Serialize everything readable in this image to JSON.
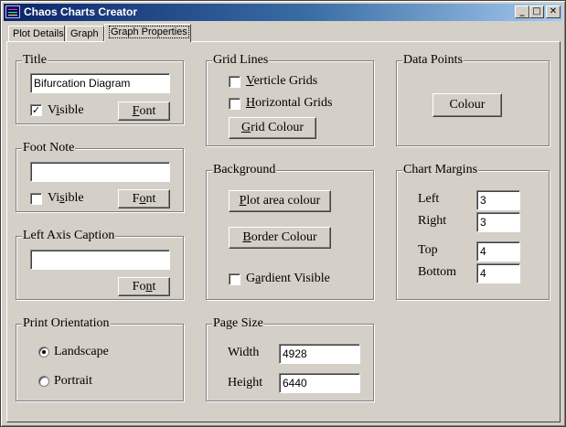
{
  "window": {
    "title": "Chaos Charts Creator",
    "controls": {
      "minimize": "_",
      "maximize": "□",
      "close": "✕"
    }
  },
  "tabs": [
    {
      "label": "Plot Details",
      "active": false
    },
    {
      "label": "Graph",
      "active": false
    },
    {
      "label": "Graph Properties",
      "active": true
    }
  ],
  "title_group": {
    "label": "Title",
    "value": "Bifurcation Diagram",
    "visible_label_pre": "V",
    "visible_label_ul": "i",
    "visible_label_post": "sible",
    "visible_checked": true,
    "font_label_pre": "",
    "font_label_ul": "F",
    "font_label_post": "ont"
  },
  "footnote_group": {
    "label": "Foot Note",
    "value": "",
    "visible_label_pre": "Vi",
    "visible_label_ul": "s",
    "visible_label_post": "ible",
    "visible_checked": false,
    "font_label_pre": "F",
    "font_label_ul": "o",
    "font_label_post": "nt"
  },
  "left_axis_group": {
    "label": "Left Axis Caption",
    "value": "",
    "font_label_pre": "Fo",
    "font_label_ul": "n",
    "font_label_post": "t"
  },
  "print_orientation": {
    "label": "Print Orientation",
    "options": [
      {
        "label": "Landscape",
        "selected": true
      },
      {
        "label": "Portrait",
        "selected": false
      }
    ]
  },
  "grid_lines": {
    "label": "Grid Lines",
    "verticle_ul": "V",
    "verticle_rest": "erticle Grids",
    "verticle_checked": false,
    "horizontal_ul": "H",
    "horizontal_rest": "orizontal Grids",
    "horizontal_checked": false,
    "colour_ul": "G",
    "colour_rest": "rid Colour"
  },
  "background": {
    "label": "Background",
    "plot_ul": "P",
    "plot_rest": "lot area colour",
    "border_ul": "B",
    "border_rest": "order Colour",
    "gradient_pre": "G",
    "gradient_ul": "a",
    "gradient_post": "rdient Visible",
    "gradient_checked": false
  },
  "page_size": {
    "label": "Page Size",
    "width_label": "Width",
    "width_value": "4928",
    "height_label": "Height",
    "height_value": "6440"
  },
  "data_points": {
    "label": "Data Points",
    "colour_label": "Colour"
  },
  "chart_margins": {
    "label": "Chart Margins",
    "left_label": "Left",
    "left_value": "3",
    "right_label": "Right",
    "right_value": "3",
    "top_label": "Top",
    "top_value": "4",
    "bottom_label": "Bottom",
    "bottom_value": "4"
  }
}
